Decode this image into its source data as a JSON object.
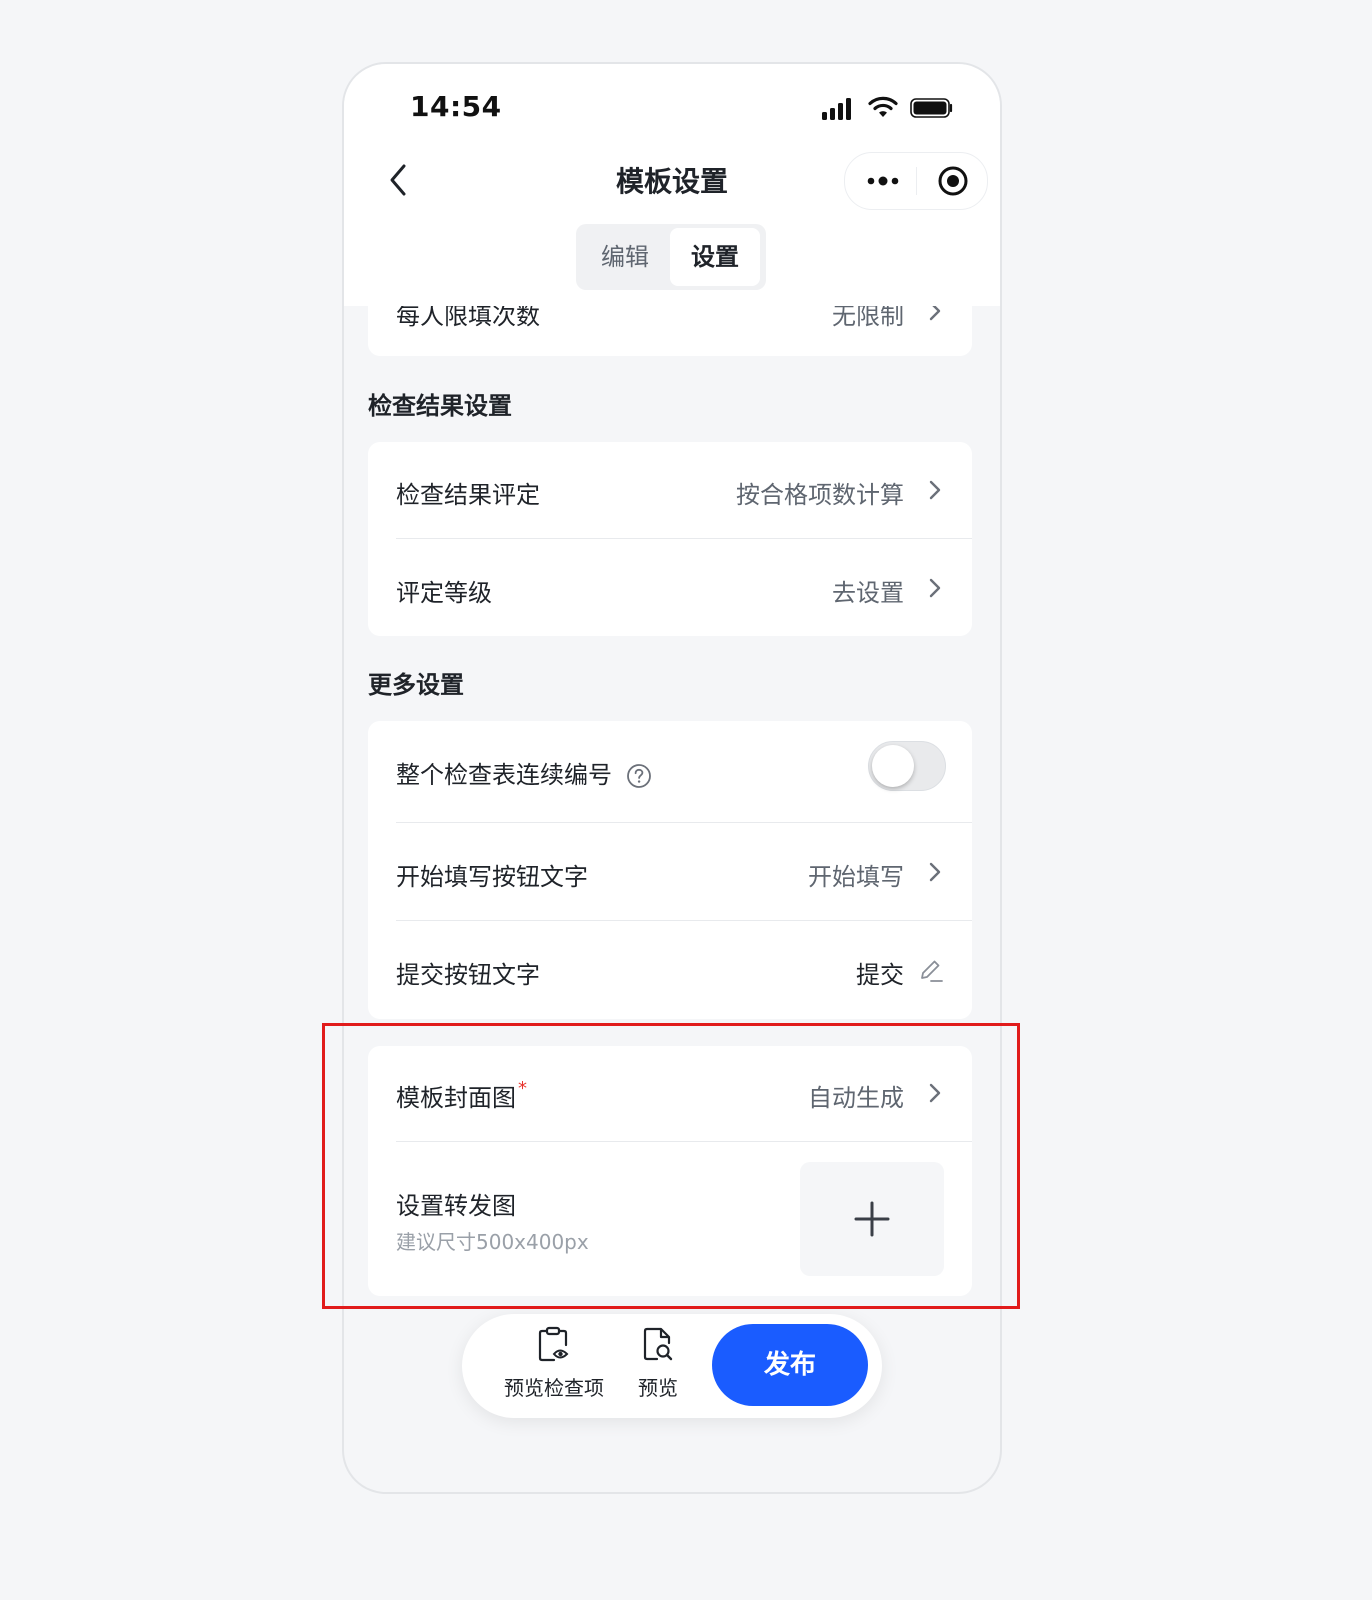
{
  "status_bar": {
    "time": "14:54"
  },
  "nav": {
    "title": "模板设置"
  },
  "tabs": [
    {
      "label": "编辑",
      "active": false
    },
    {
      "label": "设置",
      "active": true
    }
  ],
  "partial_row": {
    "label": "每人限填次数",
    "value": "无限制"
  },
  "section_result": {
    "title": "检查结果设置",
    "rows": [
      {
        "label": "检查结果评定",
        "value": "按合格项数计算"
      },
      {
        "label": "评定等级",
        "value": "去设置"
      }
    ]
  },
  "section_more": {
    "title": "更多设置",
    "serial_toggle": {
      "label": "整个检查表连续编号",
      "enabled": false
    },
    "start_button_text": {
      "label": "开始填写按钮文字",
      "value": "开始填写"
    },
    "submit_button_text": {
      "label": "提交按钮文字",
      "value": "提交"
    }
  },
  "cover_card": {
    "cover": {
      "label": "模板封面图",
      "required_mark": "*",
      "value": "自动生成"
    },
    "share": {
      "label": "设置转发图",
      "hint": "建议尺寸500x400px"
    }
  },
  "bottom_bar": {
    "preview_items_label": "预览检查项",
    "preview_label": "预览",
    "publish_label": "发布"
  },
  "colors": {
    "accent": "#1a5cff",
    "highlight_border": "#e11b1b",
    "required": "#e8332d"
  },
  "icons": [
    "back-icon",
    "more-icon",
    "target-icon",
    "help-icon",
    "chevron-right-icon",
    "edit-icon",
    "plus-icon",
    "clipboard-eye-icon",
    "doc-search-icon"
  ]
}
